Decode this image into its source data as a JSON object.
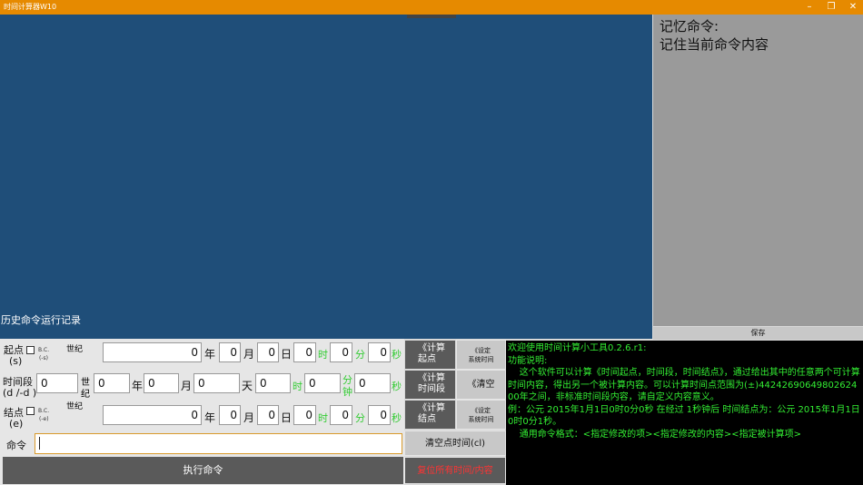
{
  "window": {
    "title": "时间计算器W10",
    "min": "–",
    "restore": "❐",
    "close": "✕"
  },
  "history": {
    "label": "历史命令运行记录"
  },
  "memory": {
    "title": "记忆命令:",
    "text": "记住当前命令内容",
    "save": "保存"
  },
  "start": {
    "label": "起点",
    "abbr": "(s)",
    "bc": "B.C.",
    "bc_abbr": "(-s)",
    "century": "世纪",
    "year": "0",
    "year_unit": "年",
    "month": "0",
    "month_unit": "月",
    "day": "0",
    "day_unit": "日",
    "hour": "0",
    "hour_unit": "时",
    "minute": "0",
    "minute_unit": "分",
    "second": "0",
    "second_unit": "秒"
  },
  "period": {
    "label": "时间段",
    "abbr": "(d /-d )",
    "century_val": "0",
    "century_1": "世",
    "century_2": "纪",
    "year": "0",
    "year_unit": "年",
    "month": "0",
    "month_unit": "月",
    "day": "0",
    "day_unit": "天",
    "hour": "0",
    "hour_unit": "时",
    "minute": "0",
    "minute_unit_1": "分",
    "minute_unit_2": "钟",
    "second": "0",
    "second_unit": "秒"
  },
  "end": {
    "label": "结点",
    "abbr": "(e)",
    "bc": "B.C.",
    "bc_abbr": "(-e)",
    "century": "世纪",
    "year": "0",
    "year_unit": "年",
    "month": "0",
    "month_unit": "月",
    "day": "0",
    "day_unit": "日",
    "hour": "0",
    "hour_unit": "时",
    "minute": "0",
    "minute_unit": "分",
    "second": "0",
    "second_unit": "秒"
  },
  "command": {
    "label": "命令",
    "value": "",
    "execute": "执行命令"
  },
  "buttons": {
    "calc_start_1": "《计算",
    "calc_start_2": "起点",
    "calc_period_1": "《计算",
    "calc_period_2": "时间段",
    "calc_end_1": "《计算",
    "calc_end_2": "结点",
    "set_sys_1a": "《设定",
    "set_sys_1b": "系统时间",
    "clear": "《清空",
    "set_sys_2a": "《设定",
    "set_sys_2b": "系统时间",
    "clear_time": "清空点时间(cl)",
    "reset_all": "复位所有时间/内容"
  },
  "console": {
    "lines": [
      "欢迎使用时间计算小工具0.2.6.r1:",
      "",
      "功能说明:",
      "    这个软件可以计算《时间起点，时间段，时间结点》，通过给出其中的任意两个可计算时间内容，得出另一个被计算内容。可以计算时间点范围为(±)44242690649802624​00年之间，非标准时间段内容，请自定义内容意义。",
      "",
      "例：公元 2015年1月1日0时0分0秒 在经过 1秒钟后 时间结点为：公元 2015年1月1日0时0分1秒。",
      "",
      "    通用命令格式：<指定修改的项><指定修改的内容><指定被计算项>"
    ]
  },
  "colors": {
    "accent": "#e68a00",
    "history_bg": "#1f4e79",
    "console_fg": "#33ee33",
    "reset_fg": "#ff3333"
  }
}
